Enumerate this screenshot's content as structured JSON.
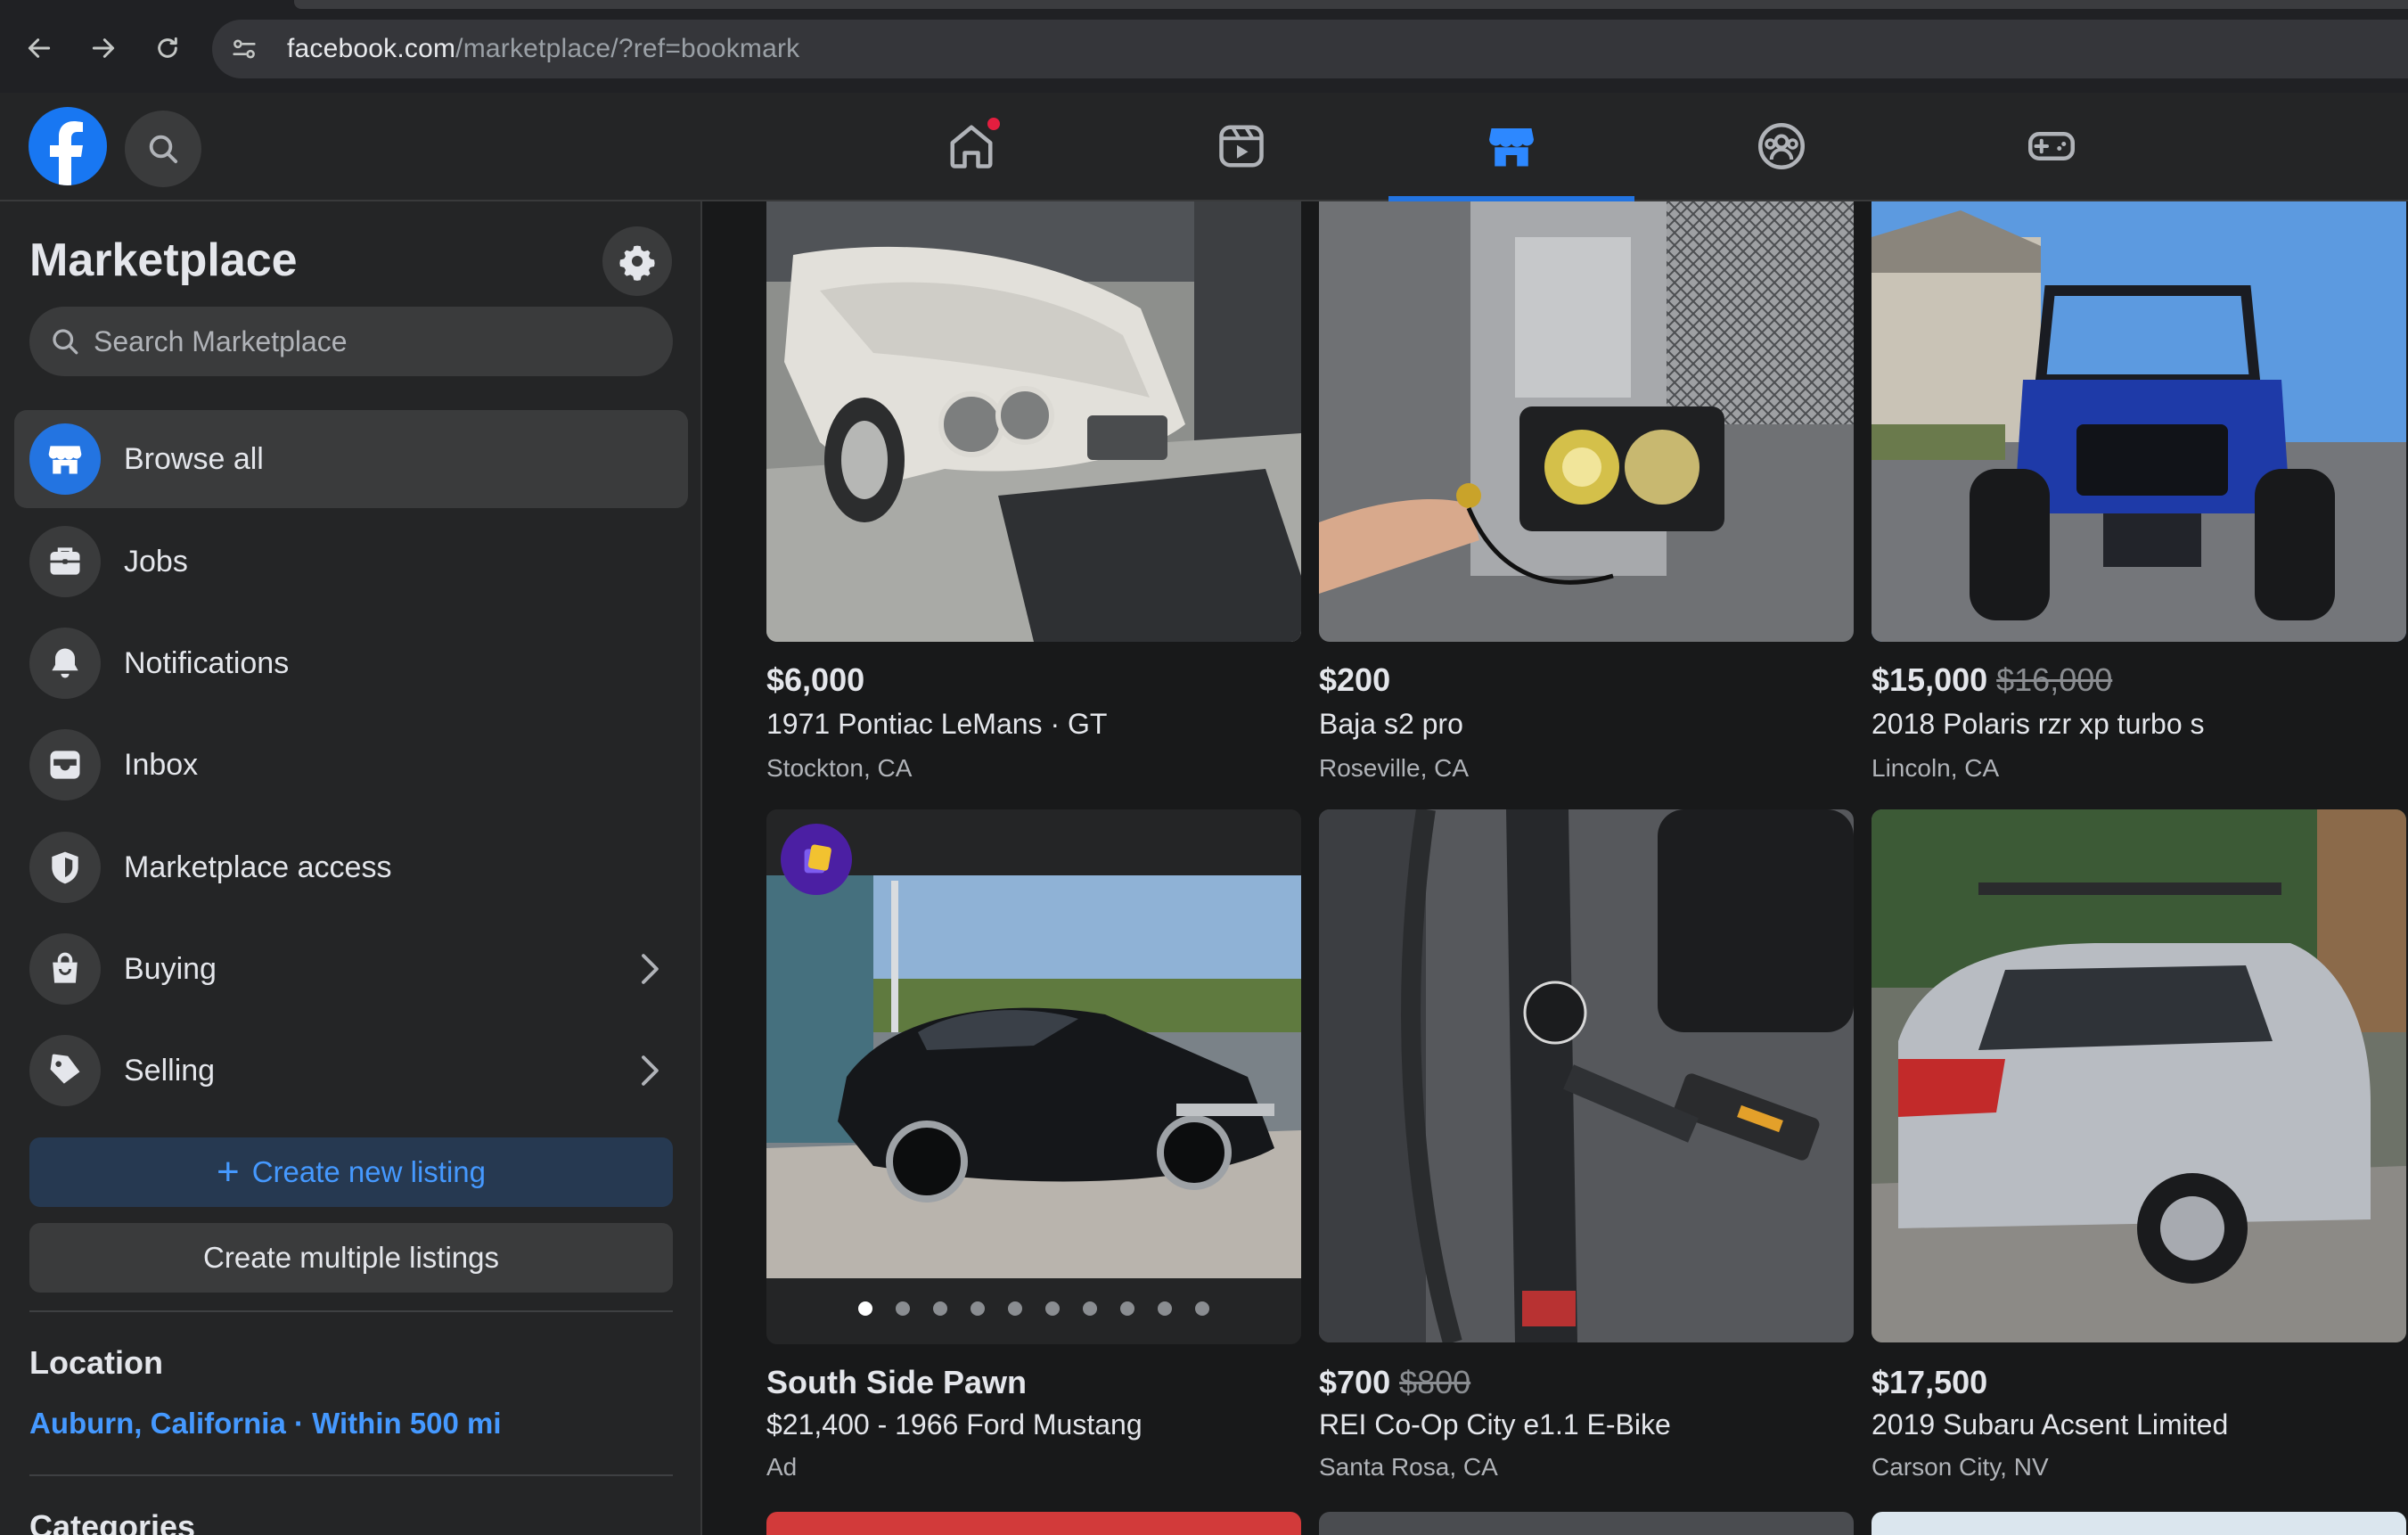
{
  "browser": {
    "url_domain": "facebook.com",
    "url_path": "/marketplace/?ref=bookmark"
  },
  "header": {
    "tabs": [
      "home",
      "video",
      "marketplace",
      "groups",
      "gaming"
    ],
    "active_tab": "marketplace"
  },
  "sidebar": {
    "title": "Marketplace",
    "search_placeholder": "Search Marketplace",
    "items": [
      {
        "label": "Browse all",
        "icon": "shop-icon"
      },
      {
        "label": "Jobs",
        "icon": "briefcase-icon"
      },
      {
        "label": "Notifications",
        "icon": "bell-icon"
      },
      {
        "label": "Inbox",
        "icon": "inbox-icon"
      },
      {
        "label": "Marketplace access",
        "icon": "shield-icon"
      },
      {
        "label": "Buying",
        "icon": "shopping-bag-icon"
      },
      {
        "label": "Selling",
        "icon": "tag-icon"
      }
    ],
    "create_listing": "Create new listing",
    "create_multiple": "Create multiple listings",
    "location_heading": "Location",
    "location_value": "Auburn, California · Within 500 mi",
    "categories_heading": "Categories"
  },
  "listings": [
    {
      "price": "$6,000",
      "old_price": "",
      "title": "1971 Pontiac LeMans · GT",
      "location": "Stockton, CA"
    },
    {
      "price": "$200",
      "old_price": "",
      "title": "Baja s2 pro",
      "location": "Roseville, CA"
    },
    {
      "price": "$15,000",
      "old_price": "$16,000",
      "title": "2018 Polaris rzr xp turbo s",
      "location": "Lincoln, CA"
    },
    {
      "price": "South Side Pawn",
      "old_price": "",
      "title": "$21,400 - 1966 Ford Mustang",
      "location": "Ad"
    },
    {
      "price": "$700",
      "old_price": "$800",
      "title": "REI Co-Op City e1.1 E-Bike",
      "location": "Santa Rosa, CA"
    },
    {
      "price": "$17,500",
      "old_price": "",
      "title": "2019 Subaru Acsent Limited",
      "location": "Carson City, NV"
    }
  ],
  "ad_carousel": {
    "slides": 10,
    "active_slide": 1
  },
  "colors": {
    "accent": "#2374e1",
    "link": "#4599ff",
    "background": "#18191a",
    "surface": "#242526"
  }
}
